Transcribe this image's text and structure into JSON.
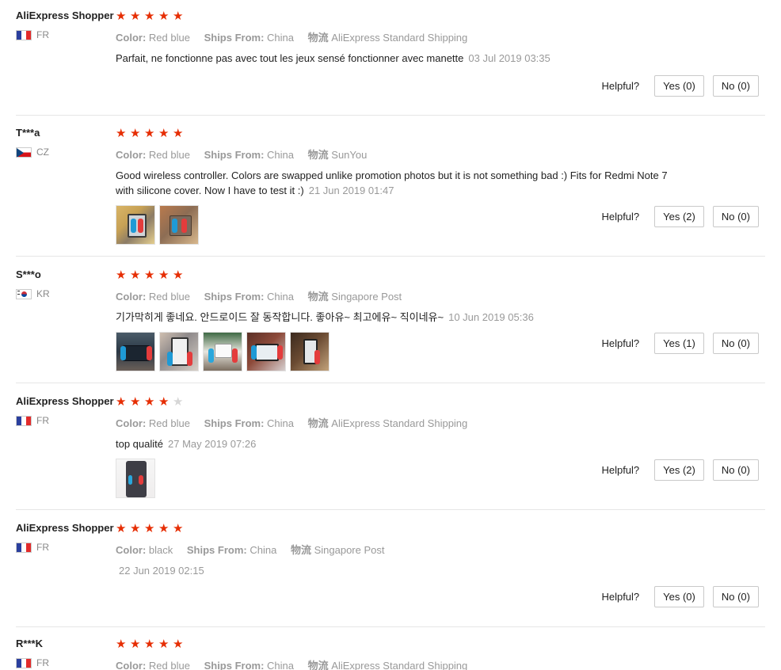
{
  "labels": {
    "color": "Color:",
    "ships_from": "Ships From:",
    "logistics": "物流",
    "helpful": "Helpful?"
  },
  "reviews": [
    {
      "user": "AliExpress Shopper",
      "country": "FR",
      "rating": 5,
      "color": "Red blue",
      "ships_from": "China",
      "logistics": "AliExpress Standard Shipping",
      "text": "Parfait, ne fonctionne pas avec tout les jeux sensé fonctionner avec manette",
      "date": "03 Jul 2019 03:35",
      "photos": [],
      "yes": "Yes (0)",
      "no": "No (0)"
    },
    {
      "user": "T***a",
      "country": "CZ",
      "rating": 5,
      "color": "Red blue",
      "ships_from": "China",
      "logistics": "SunYou",
      "text": "Good wireless controller. Colors are swapped unlike promotion photos but it is not something bad :) Fits for Redmi Note 7 with silicone cover. Now I have to test it :)",
      "date": "21 Jun 2019 01:47",
      "photos": [
        "review-photo",
        "review-photo"
      ],
      "yes": "Yes (2)",
      "no": "No (0)"
    },
    {
      "user": "S***o",
      "country": "KR",
      "rating": 5,
      "color": "Red blue",
      "ships_from": "China",
      "logistics": "Singapore Post",
      "text": "기가막히게 좋네요. 안드로이드 잘 동작합니다. 좋아유~ 최고에유~ 직이네유~",
      "date": "10 Jun 2019 05:36",
      "photos": [
        "review-photo",
        "review-photo",
        "review-photo",
        "review-photo",
        "review-photo"
      ],
      "yes": "Yes (1)",
      "no": "No (0)"
    },
    {
      "user": "AliExpress Shopper",
      "country": "FR",
      "rating": 4,
      "color": "Red blue",
      "ships_from": "China",
      "logistics": "AliExpress Standard Shipping",
      "text": "top qualité",
      "date": "27 May 2019 07:26",
      "photos": [
        "review-photo"
      ],
      "yes": "Yes (2)",
      "no": "No (0)"
    },
    {
      "user": "AliExpress Shopper",
      "country": "FR",
      "rating": 5,
      "color": "black",
      "ships_from": "China",
      "logistics": "Singapore Post",
      "text": "",
      "date": "22 Jun 2019 02:15",
      "photos": [],
      "yes": "Yes (0)",
      "no": "No (0)"
    },
    {
      "user": "R***K",
      "country": "FR",
      "rating": 5,
      "color": "Red blue",
      "ships_from": "China",
      "logistics": "AliExpress Standard Shipping",
      "text": "",
      "date": "",
      "photos": [],
      "yes": "",
      "no": ""
    }
  ],
  "colors": {
    "star": "#e62e04",
    "star_empty": "#d6d6d6",
    "meta": "#999999",
    "divider": "#e6e6e6"
  }
}
